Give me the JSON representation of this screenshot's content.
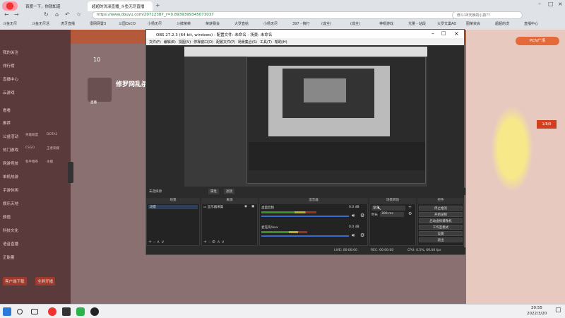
{
  "browser": {
    "tabs": [
      {
        "label": "百度一下，你就知道"
      },
      {
        "label": "超超的洗澡直播_斗鱼无尽直播 "
      }
    ],
    "url": "https://www.douyu.com/20712387_r=0.8939399345073037",
    "search_placeholder": "修斗18天换的小孩??",
    "bookmarks": [
      "斗鱼无尽",
      "斗鱼无尽活",
      "虎牙直播",
      "很网网置3",
      "三国OsCO",
      "小杨无尽",
      "斗牌荣荣",
      "荣获赛会",
      "大罗直给",
      "小杨无尽",
      "397 - 搞打",
      "(成全)",
      "(成全)",
      "神帽游戏",
      "光量 - 站段",
      "大罗文巢AO",
      "图荣资会",
      "超超的洗",
      "直播中心"
    ]
  },
  "douyu_nav": {
    "items": [
      "我的关注",
      "排行榜",
      "直播中心",
      "云游戏",
      "看看",
      "推荐",
      "公益活动",
      "热门游戏",
      "网游竞技",
      "单机热游",
      "手游休闲",
      "娱乐天地",
      "颜值",
      "科技文化",
      "语音直播",
      "正能量"
    ],
    "small_labels": [
      "英雄联盟",
      "DOTA2",
      "CSGO",
      "王者荣耀",
      "和平精英",
      "主播"
    ],
    "bottom": [
      "客户端下载",
      "全屏开播"
    ]
  },
  "streamer": {
    "fans": "10",
    "name": "修罗网乱杀",
    "tags": [
      "直播"
    ]
  },
  "right_panel": {
    "button": "PCN广场",
    "badge_text": "1/8/0",
    "date_text": "2022/3/20"
  },
  "obs": {
    "title": "OBS 27.2.3 (64-bit, windows) - 配置文件: 未命名 - 场景: 未命名",
    "menu": [
      "文件(F)",
      "编辑(E)",
      "视图(V)",
      "停靠窗口(D)",
      "配置文件(P)",
      "场景集合(S)",
      "工具(T)",
      "帮助(H)"
    ],
    "source_bar": {
      "no_source": "未选择源",
      "properties": "属性",
      "filters": "滤镜"
    },
    "docks": {
      "scenes": "场景",
      "sources": "来源",
      "mixer": "混音器",
      "transitions": "场景转场",
      "controls": "控件"
    },
    "scene_items": [
      "场景"
    ],
    "source_items": [
      "显示器采集"
    ],
    "mixer": [
      {
        "name": "桌面音频",
        "db": "0.0 dB",
        "level": 0.6
      },
      {
        "name": "麦克风/Aux",
        "db": "0.0 dB",
        "level": 0.5
      }
    ],
    "transition": {
      "type": "渐变",
      "duration_label": "时长",
      "duration": "300 ms"
    },
    "controls": [
      "停止推流",
      "开始录制",
      "启动虚拟摄像机",
      "工作室模式",
      "设置",
      "退出"
    ],
    "status": {
      "live": "LIVE: 00:00:00",
      "rec": "REC: 00:00:00",
      "cpu": "CPU: 0.5%, 60.00 fps"
    }
  },
  "taskbar": {
    "time": "20:55",
    "date": "2022/3/20"
  }
}
